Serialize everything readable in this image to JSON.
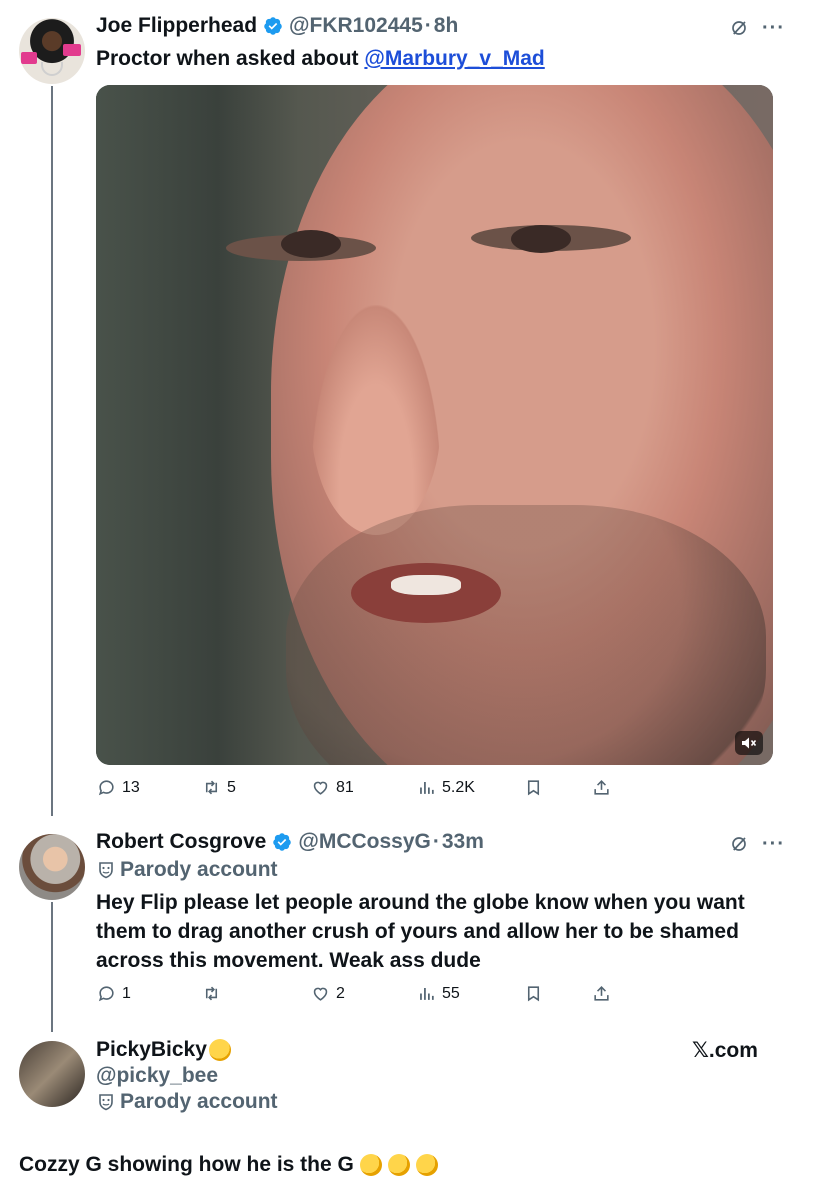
{
  "tweet1": {
    "name": "Joe Flipperhead",
    "handle": "@FKR102445",
    "separator": "·",
    "time": "8h",
    "text_prefix": "Proctor when asked about ",
    "mention": "@Marbury_v_Mad",
    "stats": {
      "replies": "13",
      "retweets": "5",
      "likes": "81",
      "views": "5.2K"
    }
  },
  "tweet2": {
    "name": "Robert Cosgrove",
    "handle": "@MCCossyG",
    "separator": "·",
    "time": "33m",
    "parody_label": "Parody account",
    "text_line1": "Hey Flip please let people around the globe know when you want",
    "text_line2": "them to drag another crush of yours and allow her to be shamed",
    "text_line3": "across this movement. Weak ass dude",
    "stats": {
      "replies": "1",
      "retweets": "",
      "likes": "2",
      "views": "55"
    }
  },
  "tweet3": {
    "name": "PickyBicky",
    "handle": "@picky_bee",
    "parody_label": "Parody account"
  },
  "watermark": {
    "x_glyph": "𝕏",
    "suffix": ".com"
  },
  "caption": "Cozzy G showing how he is the G",
  "colors": {
    "verified": "#1d9bf0",
    "mention": "#1d4ed8",
    "muted": "#536471"
  },
  "icons": [
    "verified-badge-icon",
    "grok-icon",
    "more-icon",
    "reply-icon",
    "retweet-icon",
    "like-icon",
    "views-icon",
    "bookmark-icon",
    "share-icon",
    "mute-icon",
    "parody-mask-icon",
    "pinching-hand-emoji",
    "shushing-face-emoji"
  ]
}
